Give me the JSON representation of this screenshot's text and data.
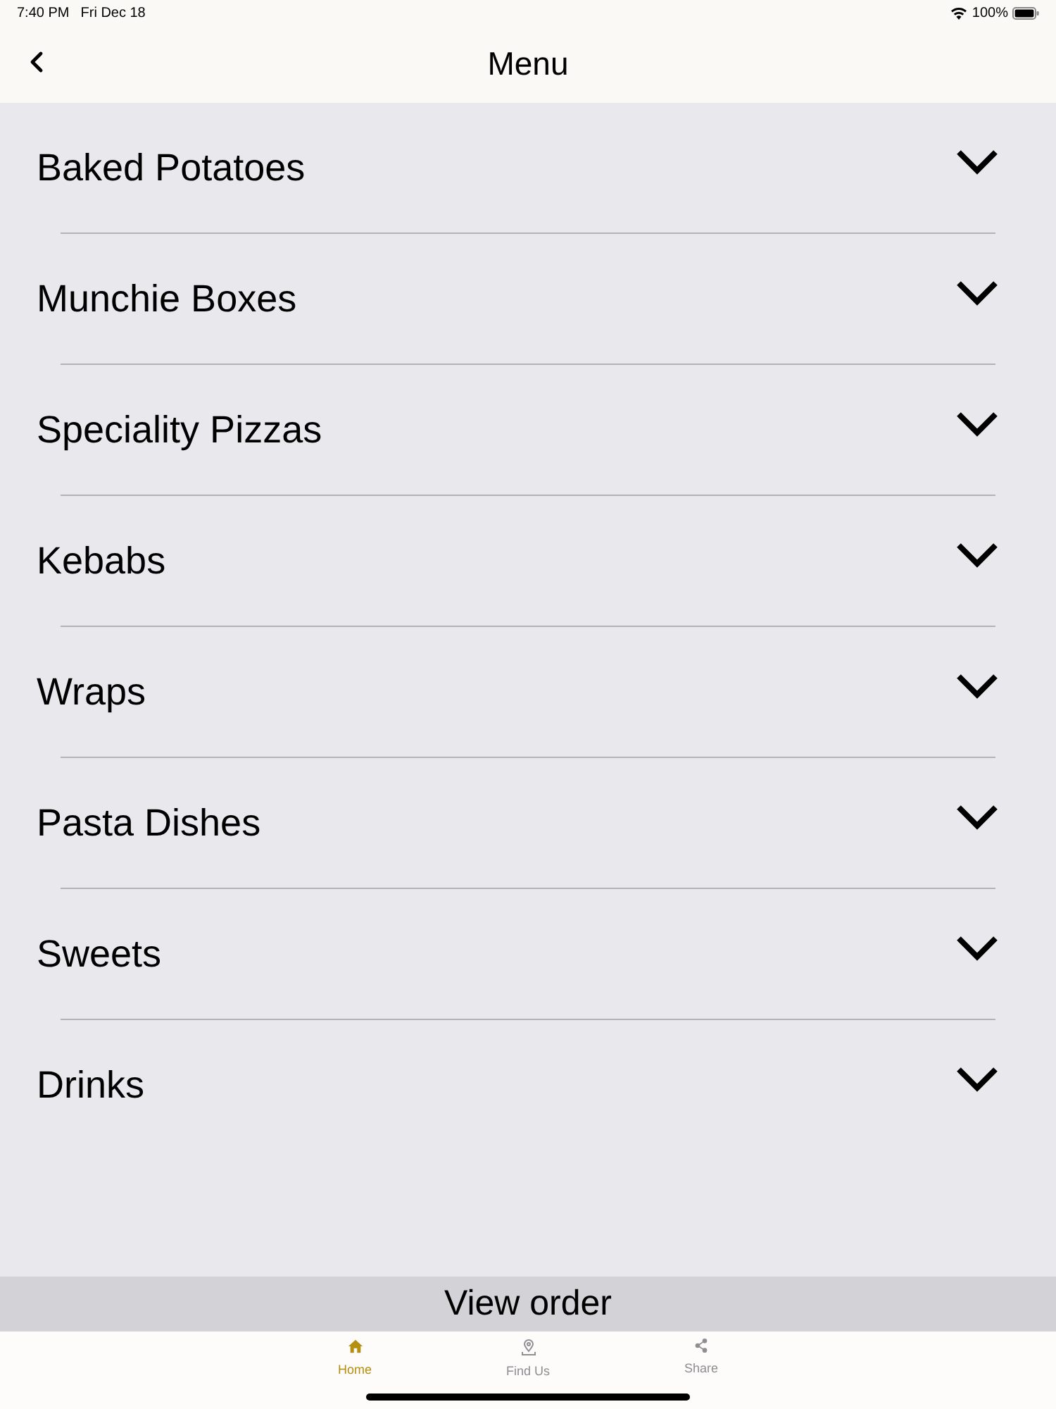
{
  "status_bar": {
    "time": "7:40 PM",
    "date": "Fri Dec 18",
    "battery": "100%"
  },
  "header": {
    "title": "Menu"
  },
  "categories": [
    {
      "label": "Baked Potatoes",
      "expanded": false
    },
    {
      "label": "Munchie Boxes",
      "expanded": false
    },
    {
      "label": "Speciality Pizzas",
      "expanded": false
    },
    {
      "label": "Kebabs",
      "expanded": false
    },
    {
      "label": "Wraps",
      "expanded": false
    },
    {
      "label": "Pasta Dishes",
      "expanded": false
    },
    {
      "label": "Sweets",
      "expanded": false
    },
    {
      "label": "Drinks",
      "expanded": false
    }
  ],
  "view_order_button": {
    "label": "View order"
  },
  "tab_bar": [
    {
      "kind": "home",
      "label": "Home",
      "selected": true
    },
    {
      "kind": "pin",
      "label": "Find Us",
      "selected": false
    },
    {
      "kind": "share",
      "label": "Share",
      "selected": false
    }
  ]
}
